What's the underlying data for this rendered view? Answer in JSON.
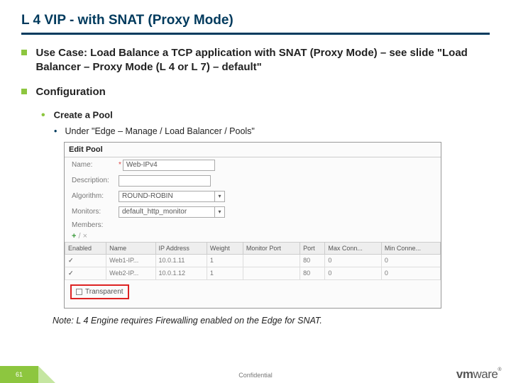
{
  "title": "L 4 VIP - with SNAT (Proxy Mode)",
  "bullets": {
    "usecase": "Use Case: Load Balance a TCP application with SNAT (Proxy Mode) – see slide \"Load Balancer – Proxy Mode (L 4 or L 7) – default\"",
    "config": "Configuration",
    "createpool": "Create a Pool",
    "under": "Under \"Edge – Manage / Load Balancer / Pools\""
  },
  "note": "Note: L 4 Engine requires Firewalling enabled on the Edge for SNAT.",
  "panel": {
    "title": "Edit Pool",
    "labels": {
      "name": "Name:",
      "description": "Description:",
      "algorithm": "Algorithm:",
      "monitors": "Monitors:",
      "members": "Members:",
      "transparent": "Transparent"
    },
    "values": {
      "name": "Web-IPv4",
      "algorithm": "ROUND-ROBIN",
      "monitors": "default_http_monitor"
    },
    "icons": {
      "plus": "+",
      "pencil": "/",
      "x": "×"
    },
    "table": {
      "headers": [
        "Enabled",
        "Name",
        "IP Address",
        "Weight",
        "Monitor Port",
        "Port",
        "Max Conn...",
        "Min Conne..."
      ],
      "rows": [
        [
          "✓",
          "Web1-IP...",
          "10.0.1.11",
          "1",
          "",
          "80",
          "0",
          "0"
        ],
        [
          "✓",
          "Web2-IP...",
          "10.0.1.12",
          "1",
          "",
          "80",
          "0",
          "0"
        ]
      ]
    }
  },
  "footer": {
    "page": "61",
    "confidential": "Confidential",
    "logo1": "vm",
    "logo2": "ware",
    "tm": "®"
  }
}
